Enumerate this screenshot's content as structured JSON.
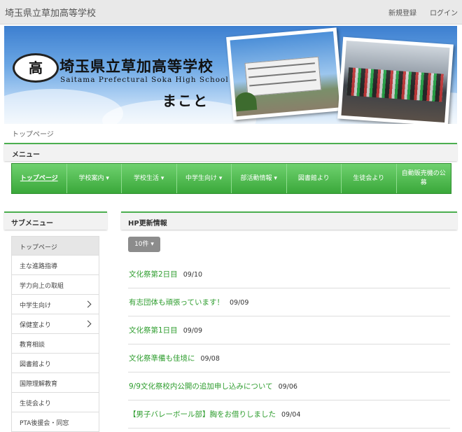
{
  "header": {
    "site_title": "埼玉県立草加高等学校",
    "register": "新規登録",
    "login": "ログイン"
  },
  "banner": {
    "emblem_text": "高",
    "school_name_jp": "埼玉県立草加高等学校",
    "school_name_en": "Saitama Prefectural Soka High School",
    "motto": "まこと"
  },
  "breadcrumb": "トップページ",
  "menu": {
    "title": "メニュー",
    "items": [
      {
        "label": "トップページ"
      },
      {
        "label": "学校案内 ▾"
      },
      {
        "label": "学校生活 ▾"
      },
      {
        "label": "中学生向け ▾"
      },
      {
        "label": "部活動情報 ▾"
      },
      {
        "label": "図書館より"
      },
      {
        "label": "生徒会より"
      },
      {
        "label": "自動販売機の公募"
      }
    ]
  },
  "submenu": {
    "title": "サブメニュー",
    "items": [
      {
        "label": "トップページ",
        "chevron": false
      },
      {
        "label": "主な進路指導",
        "chevron": false
      },
      {
        "label": "学力向上の取組",
        "chevron": false
      },
      {
        "label": "中学生向け",
        "chevron": true
      },
      {
        "label": "保健室より",
        "chevron": true
      },
      {
        "label": "教育相談",
        "chevron": false
      },
      {
        "label": "図書館より",
        "chevron": false
      },
      {
        "label": "国際理解教育",
        "chevron": false
      },
      {
        "label": "生徒会より",
        "chevron": false
      },
      {
        "label": "PTA後援会・同窓",
        "chevron": false
      }
    ]
  },
  "news": {
    "title": "HP更新情報",
    "count_label": "10件 ▾",
    "items": [
      {
        "title": "文化祭第2日目",
        "date": "09/10"
      },
      {
        "title": "有志団体も頑張っています！",
        "date": "09/09"
      },
      {
        "title": "文化祭第1日目",
        "date": "09/09"
      },
      {
        "title": "文化祭準備も佳境に",
        "date": "09/08"
      },
      {
        "title": "9/9文化祭校内公開の追加申し込みについて",
        "date": "09/06"
      },
      {
        "title": "【男子バレーボール部】胸をお借りしました",
        "date": "09/04"
      }
    ]
  },
  "colors": {
    "accent_green": "#4caf50",
    "link_green": "#2e9d2e",
    "nav_green": "#3aa83a"
  }
}
